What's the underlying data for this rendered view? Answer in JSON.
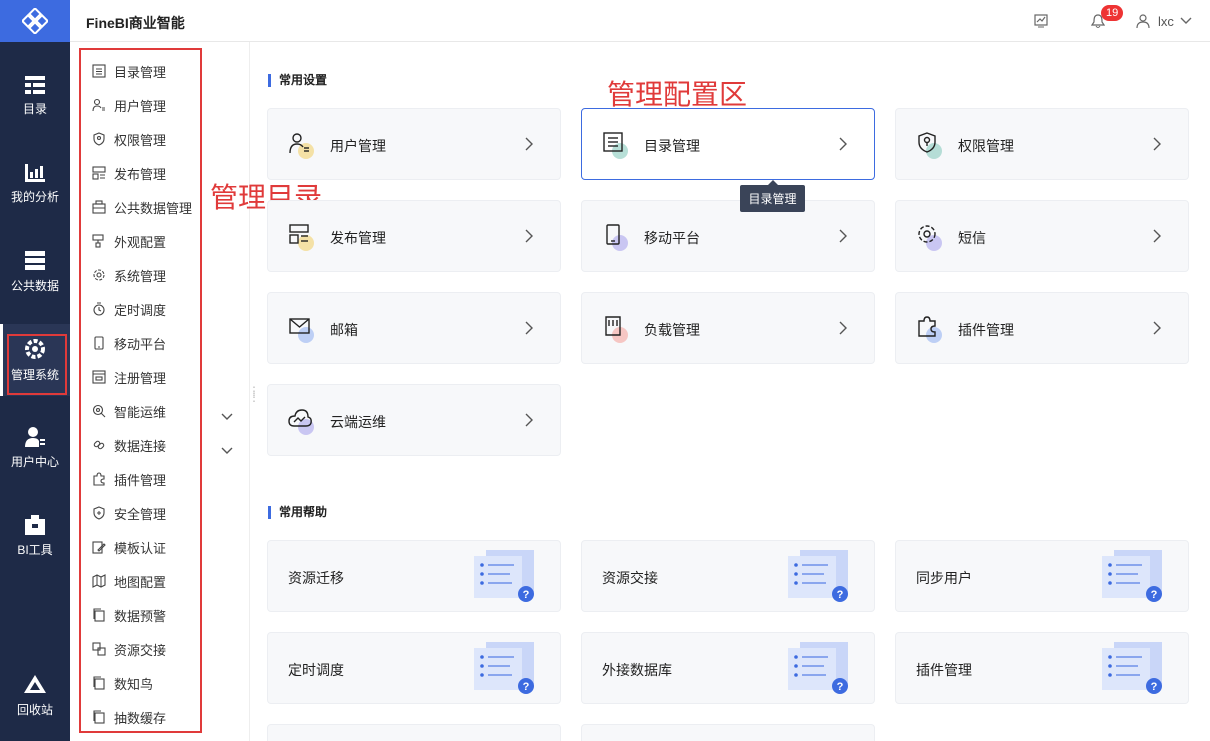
{
  "header": {
    "title": "FineBI商业智能",
    "notification_count": "19",
    "user": "lxc"
  },
  "rail": {
    "items": [
      {
        "label": "目录",
        "icon": "catalog-icon"
      },
      {
        "label": "我的分析",
        "icon": "analysis-icon"
      },
      {
        "label": "公共数据",
        "icon": "database-icon"
      },
      {
        "label": "管理系统",
        "icon": "gear-icon"
      },
      {
        "label": "用户中心",
        "icon": "user-center-icon"
      },
      {
        "label": "BI工具",
        "icon": "toolbox-icon"
      },
      {
        "label": "回收站",
        "icon": "recycle-icon"
      }
    ]
  },
  "menu": {
    "items": [
      {
        "label": "目录管理"
      },
      {
        "label": "用户管理"
      },
      {
        "label": "权限管理"
      },
      {
        "label": "发布管理"
      },
      {
        "label": "公共数据管理"
      },
      {
        "label": "外观配置"
      },
      {
        "label": "系统管理"
      },
      {
        "label": "定时调度"
      },
      {
        "label": "移动平台"
      },
      {
        "label": "注册管理"
      },
      {
        "label": "智能运维"
      },
      {
        "label": "数据连接"
      },
      {
        "label": "插件管理"
      },
      {
        "label": "安全管理"
      },
      {
        "label": "模板认证"
      },
      {
        "label": "地图配置"
      },
      {
        "label": "数据预警"
      },
      {
        "label": "资源交接"
      },
      {
        "label": "数知鸟"
      },
      {
        "label": "抽数缓存"
      }
    ]
  },
  "annotations": {
    "menu": "管理目录",
    "config": "管理配置区"
  },
  "settings": {
    "title": "常用设置",
    "cards": [
      {
        "label": "用户管理"
      },
      {
        "label": "目录管理"
      },
      {
        "label": "权限管理"
      },
      {
        "label": "发布管理"
      },
      {
        "label": "移动平台"
      },
      {
        "label": "短信"
      },
      {
        "label": "邮箱"
      },
      {
        "label": "负载管理"
      },
      {
        "label": "插件管理"
      },
      {
        "label": "云端运维"
      }
    ],
    "tooltip": "目录管理"
  },
  "help": {
    "title": "常用帮助",
    "cards": [
      {
        "label": "资源迁移"
      },
      {
        "label": "资源交接"
      },
      {
        "label": "同步用户"
      },
      {
        "label": "定时调度"
      },
      {
        "label": "外接数据库"
      },
      {
        "label": "插件管理"
      }
    ]
  }
}
